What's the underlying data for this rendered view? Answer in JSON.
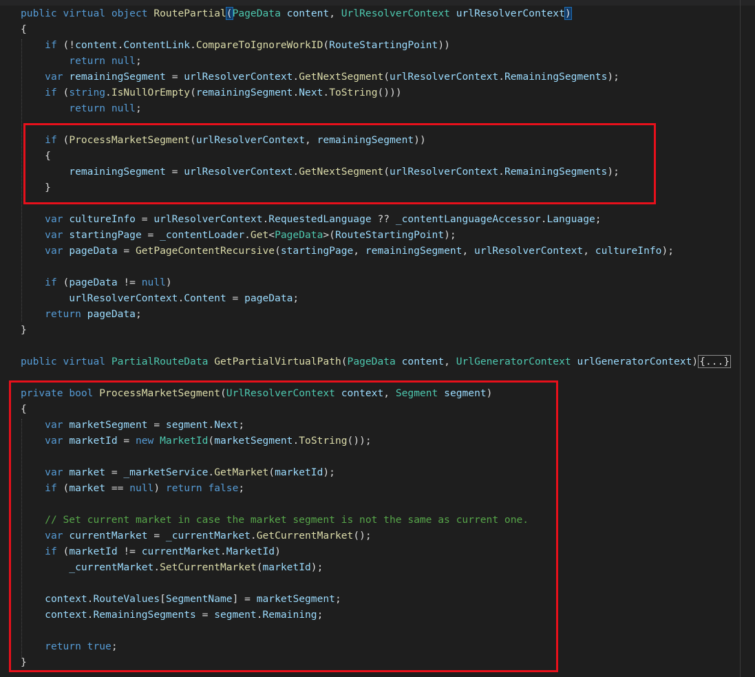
{
  "colors": {
    "background": "#1e1e1e",
    "keyword": "#569cd6",
    "type": "#4ec9b0",
    "method": "#dcdcaa",
    "identifier": "#9cdcfe",
    "plain": "#dcdcdc",
    "comment": "#57a64a",
    "highlight_box": "#e8101b"
  },
  "code_lines": [
    {
      "tokens": [
        [
          "kw",
          "public"
        ],
        [
          "pl",
          " "
        ],
        [
          "kw",
          "virtual"
        ],
        [
          "pl",
          " "
        ],
        [
          "kw",
          "object"
        ],
        [
          "pl",
          " "
        ],
        [
          "me",
          "RoutePartial"
        ],
        [
          "pm",
          "("
        ],
        [
          "ty",
          "PageData"
        ],
        [
          "pl",
          " "
        ],
        [
          "va",
          "content"
        ],
        [
          "pl",
          ", "
        ],
        [
          "ty",
          "UrlResolverContext"
        ],
        [
          "pl",
          " "
        ],
        [
          "va",
          "urlResolverContext"
        ],
        [
          "pm",
          ")"
        ]
      ]
    },
    {
      "tokens": [
        [
          "pl",
          "{"
        ]
      ]
    },
    {
      "tokens": [
        [
          "pl",
          "    "
        ],
        [
          "kw",
          "if"
        ],
        [
          "pl",
          " (!"
        ],
        [
          "va",
          "content"
        ],
        [
          "pl",
          "."
        ],
        [
          "va",
          "ContentLink"
        ],
        [
          "pl",
          "."
        ],
        [
          "me",
          "CompareToIgnoreWorkID"
        ],
        [
          "pl",
          "("
        ],
        [
          "va",
          "RouteStartingPoint"
        ],
        [
          "pl",
          "))"
        ]
      ]
    },
    {
      "tokens": [
        [
          "pl",
          "        "
        ],
        [
          "kw",
          "return"
        ],
        [
          "pl",
          " "
        ],
        [
          "kw",
          "null"
        ],
        [
          "pl",
          ";"
        ]
      ]
    },
    {
      "tokens": [
        [
          "pl",
          "    "
        ],
        [
          "kw",
          "var"
        ],
        [
          "pl",
          " "
        ],
        [
          "va",
          "remainingSegment"
        ],
        [
          "pl",
          " = "
        ],
        [
          "va",
          "urlResolverContext"
        ],
        [
          "pl",
          "."
        ],
        [
          "me",
          "GetNextSegment"
        ],
        [
          "pl",
          "("
        ],
        [
          "va",
          "urlResolverContext"
        ],
        [
          "pl",
          "."
        ],
        [
          "va",
          "RemainingSegments"
        ],
        [
          "pl",
          ");"
        ]
      ]
    },
    {
      "tokens": [
        [
          "pl",
          "    "
        ],
        [
          "kw",
          "if"
        ],
        [
          "pl",
          " ("
        ],
        [
          "kw",
          "string"
        ],
        [
          "pl",
          "."
        ],
        [
          "me",
          "IsNullOrEmpty"
        ],
        [
          "pl",
          "("
        ],
        [
          "va",
          "remainingSegment"
        ],
        [
          "pl",
          "."
        ],
        [
          "va",
          "Next"
        ],
        [
          "pl",
          "."
        ],
        [
          "me",
          "ToString"
        ],
        [
          "pl",
          "()))"
        ]
      ]
    },
    {
      "tokens": [
        [
          "pl",
          "        "
        ],
        [
          "kw",
          "return"
        ],
        [
          "pl",
          " "
        ],
        [
          "kw",
          "null"
        ],
        [
          "pl",
          ";"
        ]
      ]
    },
    {
      "tokens": []
    },
    {
      "tokens": [
        [
          "pl",
          "    "
        ],
        [
          "kw",
          "if"
        ],
        [
          "pl",
          " ("
        ],
        [
          "me",
          "ProcessMarketSegment"
        ],
        [
          "pl",
          "("
        ],
        [
          "va",
          "urlResolverContext"
        ],
        [
          "pl",
          ", "
        ],
        [
          "va",
          "remainingSegment"
        ],
        [
          "pl",
          "))"
        ]
      ]
    },
    {
      "tokens": [
        [
          "pl",
          "    {"
        ]
      ]
    },
    {
      "tokens": [
        [
          "pl",
          "        "
        ],
        [
          "va",
          "remainingSegment"
        ],
        [
          "pl",
          " = "
        ],
        [
          "va",
          "urlResolverContext"
        ],
        [
          "pl",
          "."
        ],
        [
          "me",
          "GetNextSegment"
        ],
        [
          "pl",
          "("
        ],
        [
          "va",
          "urlResolverContext"
        ],
        [
          "pl",
          "."
        ],
        [
          "va",
          "RemainingSegments"
        ],
        [
          "pl",
          ");"
        ]
      ]
    },
    {
      "tokens": [
        [
          "pl",
          "    }"
        ]
      ]
    },
    {
      "tokens": []
    },
    {
      "tokens": [
        [
          "pl",
          "    "
        ],
        [
          "kw",
          "var"
        ],
        [
          "pl",
          " "
        ],
        [
          "va",
          "cultureInfo"
        ],
        [
          "pl",
          " = "
        ],
        [
          "va",
          "urlResolverContext"
        ],
        [
          "pl",
          "."
        ],
        [
          "va",
          "RequestedLanguage"
        ],
        [
          "pl",
          " ?? "
        ],
        [
          "va",
          "_contentLanguageAccessor"
        ],
        [
          "pl",
          "."
        ],
        [
          "va",
          "Language"
        ],
        [
          "pl",
          ";"
        ]
      ]
    },
    {
      "tokens": [
        [
          "pl",
          "    "
        ],
        [
          "kw",
          "var"
        ],
        [
          "pl",
          " "
        ],
        [
          "va",
          "startingPage"
        ],
        [
          "pl",
          " = "
        ],
        [
          "va",
          "_contentLoader"
        ],
        [
          "pl",
          "."
        ],
        [
          "me",
          "Get"
        ],
        [
          "pl",
          "<"
        ],
        [
          "ty",
          "PageData"
        ],
        [
          "pl",
          ">("
        ],
        [
          "va",
          "RouteStartingPoint"
        ],
        [
          "pl",
          ");"
        ]
      ]
    },
    {
      "tokens": [
        [
          "pl",
          "    "
        ],
        [
          "kw",
          "var"
        ],
        [
          "pl",
          " "
        ],
        [
          "va",
          "pageData"
        ],
        [
          "pl",
          " = "
        ],
        [
          "me",
          "GetPageContentRecursive"
        ],
        [
          "pl",
          "("
        ],
        [
          "va",
          "startingPage"
        ],
        [
          "pl",
          ", "
        ],
        [
          "va",
          "remainingSegment"
        ],
        [
          "pl",
          ", "
        ],
        [
          "va",
          "urlResolverContext"
        ],
        [
          "pl",
          ", "
        ],
        [
          "va",
          "cultureInfo"
        ],
        [
          "pl",
          ");"
        ]
      ]
    },
    {
      "tokens": []
    },
    {
      "tokens": [
        [
          "pl",
          "    "
        ],
        [
          "kw",
          "if"
        ],
        [
          "pl",
          " ("
        ],
        [
          "va",
          "pageData"
        ],
        [
          "pl",
          " != "
        ],
        [
          "kw",
          "null"
        ],
        [
          "pl",
          ")"
        ]
      ]
    },
    {
      "tokens": [
        [
          "pl",
          "        "
        ],
        [
          "va",
          "urlResolverContext"
        ],
        [
          "pl",
          "."
        ],
        [
          "va",
          "Content"
        ],
        [
          "pl",
          " = "
        ],
        [
          "va",
          "pageData"
        ],
        [
          "pl",
          ";"
        ]
      ]
    },
    {
      "tokens": [
        [
          "pl",
          "    "
        ],
        [
          "kw",
          "return"
        ],
        [
          "pl",
          " "
        ],
        [
          "va",
          "pageData"
        ],
        [
          "pl",
          ";"
        ]
      ]
    },
    {
      "tokens": [
        [
          "pl",
          "}"
        ]
      ]
    },
    {
      "tokens": []
    },
    {
      "tokens": [
        [
          "kw",
          "public"
        ],
        [
          "pl",
          " "
        ],
        [
          "kw",
          "virtual"
        ],
        [
          "pl",
          " "
        ],
        [
          "ty",
          "PartialRouteData"
        ],
        [
          "pl",
          " "
        ],
        [
          "me",
          "GetPartialVirtualPath"
        ],
        [
          "pl",
          "("
        ],
        [
          "ty",
          "PageData"
        ],
        [
          "pl",
          " "
        ],
        [
          "va",
          "content"
        ],
        [
          "pl",
          ", "
        ],
        [
          "ty",
          "UrlGeneratorContext"
        ],
        [
          "pl",
          " "
        ],
        [
          "va",
          "urlGeneratorContext"
        ],
        [
          "pl",
          ")"
        ],
        [
          "cb",
          "{...}"
        ]
      ]
    },
    {
      "tokens": []
    },
    {
      "tokens": [
        [
          "kw",
          "private"
        ],
        [
          "pl",
          " "
        ],
        [
          "kw",
          "bool"
        ],
        [
          "pl",
          " "
        ],
        [
          "me",
          "ProcessMarketSegment"
        ],
        [
          "pl",
          "("
        ],
        [
          "ty",
          "UrlResolverContext"
        ],
        [
          "pl",
          " "
        ],
        [
          "va",
          "context"
        ],
        [
          "pl",
          ", "
        ],
        [
          "ty",
          "Segment"
        ],
        [
          "pl",
          " "
        ],
        [
          "va",
          "segment"
        ],
        [
          "pl",
          ")"
        ]
      ]
    },
    {
      "tokens": [
        [
          "pl",
          "{"
        ]
      ]
    },
    {
      "tokens": [
        [
          "pl",
          "    "
        ],
        [
          "kw",
          "var"
        ],
        [
          "pl",
          " "
        ],
        [
          "va",
          "marketSegment"
        ],
        [
          "pl",
          " = "
        ],
        [
          "va",
          "segment"
        ],
        [
          "pl",
          "."
        ],
        [
          "va",
          "Next"
        ],
        [
          "pl",
          ";"
        ]
      ]
    },
    {
      "tokens": [
        [
          "pl",
          "    "
        ],
        [
          "kw",
          "var"
        ],
        [
          "pl",
          " "
        ],
        [
          "va",
          "marketId"
        ],
        [
          "pl",
          " = "
        ],
        [
          "kw",
          "new"
        ],
        [
          "pl",
          " "
        ],
        [
          "ty",
          "MarketId"
        ],
        [
          "pl",
          "("
        ],
        [
          "va",
          "marketSegment"
        ],
        [
          "pl",
          "."
        ],
        [
          "me",
          "ToString"
        ],
        [
          "pl",
          "());"
        ]
      ]
    },
    {
      "tokens": []
    },
    {
      "tokens": [
        [
          "pl",
          "    "
        ],
        [
          "kw",
          "var"
        ],
        [
          "pl",
          " "
        ],
        [
          "va",
          "market"
        ],
        [
          "pl",
          " = "
        ],
        [
          "va",
          "_marketService"
        ],
        [
          "pl",
          "."
        ],
        [
          "me",
          "GetMarket"
        ],
        [
          "pl",
          "("
        ],
        [
          "va",
          "marketId"
        ],
        [
          "pl",
          ");"
        ]
      ]
    },
    {
      "tokens": [
        [
          "pl",
          "    "
        ],
        [
          "kw",
          "if"
        ],
        [
          "pl",
          " ("
        ],
        [
          "va",
          "market"
        ],
        [
          "pl",
          " == "
        ],
        [
          "kw",
          "null"
        ],
        [
          "pl",
          ") "
        ],
        [
          "kw",
          "return"
        ],
        [
          "pl",
          " "
        ],
        [
          "kw",
          "false"
        ],
        [
          "pl",
          ";"
        ]
      ]
    },
    {
      "tokens": []
    },
    {
      "tokens": [
        [
          "pl",
          "    "
        ],
        [
          "cm",
          "// Set current market in case the market segment is not the same as current one."
        ]
      ]
    },
    {
      "tokens": [
        [
          "pl",
          "    "
        ],
        [
          "kw",
          "var"
        ],
        [
          "pl",
          " "
        ],
        [
          "va",
          "currentMarket"
        ],
        [
          "pl",
          " = "
        ],
        [
          "va",
          "_currentMarket"
        ],
        [
          "pl",
          "."
        ],
        [
          "me",
          "GetCurrentMarket"
        ],
        [
          "pl",
          "();"
        ]
      ]
    },
    {
      "tokens": [
        [
          "pl",
          "    "
        ],
        [
          "kw",
          "if"
        ],
        [
          "pl",
          " ("
        ],
        [
          "va",
          "marketId"
        ],
        [
          "pl",
          " != "
        ],
        [
          "va",
          "currentMarket"
        ],
        [
          "pl",
          "."
        ],
        [
          "va",
          "MarketId"
        ],
        [
          "pl",
          ")"
        ]
      ]
    },
    {
      "tokens": [
        [
          "pl",
          "        "
        ],
        [
          "va",
          "_currentMarket"
        ],
        [
          "pl",
          "."
        ],
        [
          "me",
          "SetCurrentMarket"
        ],
        [
          "pl",
          "("
        ],
        [
          "va",
          "marketId"
        ],
        [
          "pl",
          ");"
        ]
      ]
    },
    {
      "tokens": []
    },
    {
      "tokens": [
        [
          "pl",
          "    "
        ],
        [
          "va",
          "context"
        ],
        [
          "pl",
          "."
        ],
        [
          "va",
          "RouteValues"
        ],
        [
          "pl",
          "["
        ],
        [
          "va",
          "SegmentName"
        ],
        [
          "pl",
          "] = "
        ],
        [
          "va",
          "marketSegment"
        ],
        [
          "pl",
          ";"
        ]
      ]
    },
    {
      "tokens": [
        [
          "pl",
          "    "
        ],
        [
          "va",
          "context"
        ],
        [
          "pl",
          "."
        ],
        [
          "va",
          "RemainingSegments"
        ],
        [
          "pl",
          " = "
        ],
        [
          "va",
          "segment"
        ],
        [
          "pl",
          "."
        ],
        [
          "va",
          "Remaining"
        ],
        [
          "pl",
          ";"
        ]
      ]
    },
    {
      "tokens": []
    },
    {
      "tokens": [
        [
          "pl",
          "    "
        ],
        [
          "kw",
          "return"
        ],
        [
          "pl",
          " "
        ],
        [
          "kw",
          "true"
        ],
        [
          "pl",
          ";"
        ]
      ]
    },
    {
      "tokens": [
        [
          "pl",
          "}"
        ]
      ]
    }
  ]
}
